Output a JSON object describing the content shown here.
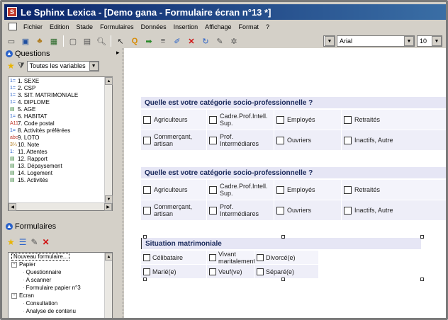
{
  "app": {
    "title": "Le Sphinx Lexica - [Demo gana - Formulaire écran n°13 *]"
  },
  "menu": [
    "Fichier",
    "Edition",
    "Stade",
    "Formulaires",
    "Données",
    "Insertion",
    "Affichage",
    "Format",
    "?"
  ],
  "font": {
    "name": "Arial",
    "size": "10"
  },
  "questions_panel": {
    "title": "Questions",
    "filter": "Toutes les variables",
    "items": [
      {
        "label": "1. SEXE",
        "icon": "closed-choice-icon"
      },
      {
        "label": "2. CSP",
        "icon": "closed-choice-icon"
      },
      {
        "label": "3. SIT. MATRIMONIALE",
        "icon": "closed-choice-icon"
      },
      {
        "label": "4. DIPLOME",
        "icon": "multiple-choice-icon"
      },
      {
        "label": "5. AGE",
        "icon": "numeric-icon"
      },
      {
        "label": "6. HABITAT",
        "icon": "closed-choice-icon"
      },
      {
        "label": "7. Code postal",
        "icon": "text-icon"
      },
      {
        "label": "8. Activités préférées",
        "icon": "multiple-choice-icon"
      },
      {
        "label": "9. LOTO",
        "icon": "text-icon"
      },
      {
        "label": "10. Note",
        "icon": "scale-icon"
      },
      {
        "label": "11. Attentes",
        "icon": "ordered-icon"
      },
      {
        "label": "12. Rapport",
        "icon": "numeric-icon"
      },
      {
        "label": "13. Dépaysement",
        "icon": "numeric-icon"
      },
      {
        "label": "14. Logement",
        "icon": "numeric-icon"
      },
      {
        "label": "15. Activités",
        "icon": "numeric-icon"
      }
    ],
    "icon_glyphs": [
      "1=",
      "1=",
      "1=",
      "1=",
      "▤",
      "1=",
      "A11",
      "1=",
      "abc",
      "3¼",
      "1:",
      "▤",
      "▤",
      "▤",
      "▤"
    ]
  },
  "forms_panel": {
    "title": "Formulaires",
    "tree": [
      {
        "label": "Nouveau formulaire...",
        "level": 0,
        "selected": true
      },
      {
        "label": "Papier",
        "level": 0,
        "expander": "-"
      },
      {
        "label": "Questionnaire",
        "level": 2
      },
      {
        "label": "A scanner",
        "level": 2
      },
      {
        "label": "Formulaire papier n°3",
        "level": 2
      },
      {
        "label": "Ecran",
        "level": 0,
        "expander": "-"
      },
      {
        "label": "Consultation",
        "level": 2
      },
      {
        "label": "Analyse de contenu",
        "level": 2
      }
    ]
  },
  "form": {
    "q1": {
      "title": "Quelle est votre catégorie socio-professionnelle ?",
      "options": [
        "Agriculteurs",
        "Cadre.Prof.Intell.\nSup.",
        "Employés",
        "Retraités",
        "Commerçant,\nartisan",
        "Prof.\nIntermédiares",
        "Ouvriers",
        "Inactifs, Autre"
      ]
    },
    "q2": {
      "title": "Quelle est votre catégorie socio-professionnelle ?",
      "options": [
        "Agriculteurs",
        "Cadre.Prof.Intell.\nSup.",
        "Employés",
        "Retraités",
        "Commerçant,\nartisan",
        "Prof.\nIntermédiares",
        "Ouvriers",
        "Inactifs, Autre"
      ]
    },
    "q3": {
      "title": "Situation matrimoniale",
      "options": [
        "Célibataire",
        "Vivant\nmaritalement",
        "Divorcé(e)",
        "Marié(e)",
        "Veuf(ve)",
        "Séparé(e)"
      ]
    }
  }
}
